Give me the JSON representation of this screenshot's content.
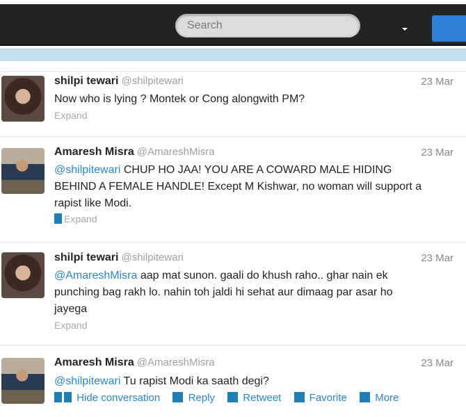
{
  "header": {
    "search_placeholder": "Search"
  },
  "tweets": [
    {
      "name": "shilpi tewari",
      "handle": "@shilpitewari",
      "date": "23 Mar",
      "text": "Now who is lying ? Montek or Cong alongwith PM?",
      "expand": "Expand"
    },
    {
      "name": "Amaresh Misra",
      "handle": "@AmareshMisra",
      "date": "23 Mar",
      "mention": "@shilpitewari",
      "text_line1": " CHUP HO JAA! YOU ARE A COWARD MALE HIDING",
      "text_line2": "BEHIND A FEMALE HANDLE! Except M Kishwar, no woman will support a",
      "text_line3": "rapist like Modi.",
      "expand": "Expand"
    },
    {
      "name": "shilpi tewari",
      "handle": "@shilpitewari",
      "date": "23 Mar",
      "mention": "@AmareshMisra",
      "text_line1": " aap mat sunon. gaali do khush raho.. ghar nain ek",
      "text_line2": "punching bag rakh lo. nahin toh jaldi hi sehat aur dimaag par asar ho",
      "text_line3": "jayega",
      "expand": "Expand"
    },
    {
      "name": "Amaresh Misra",
      "handle": "@AmareshMisra",
      "date": "23 Mar",
      "mention": "@shilpitewari",
      "text_line1": " Tu rapist Modi ka saath degi?",
      "actions": {
        "hide": "Hide conversation",
        "reply": "Reply",
        "retweet": "Retweet",
        "favorite": "Favorite",
        "more": "More"
      }
    }
  ],
  "colors": {
    "topbar": "#232323",
    "link": "#2a86c9",
    "action_square": "#1d7fb5"
  }
}
